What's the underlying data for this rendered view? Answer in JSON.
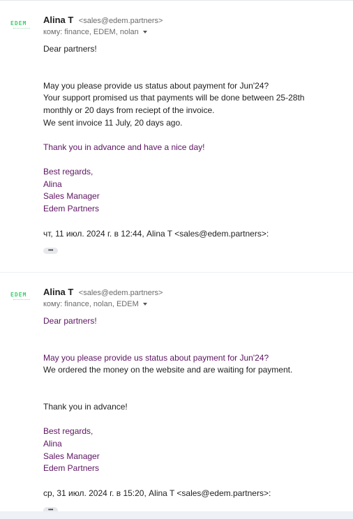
{
  "messages": [
    {
      "sender_name": "Alina T",
      "sender_email": "<sales@edem.partners>",
      "to": "кому: finance, EDEM, nolan",
      "logo_text": "EDEM",
      "body": {
        "greeting": "Dear partners!",
        "p1_line1": "May you please provide us status about payment for Jun'24?",
        "p1_line2": "Your support promised us that payments will be done between 25-28th",
        "p1_line3": "monthly or 20 days from reciept of the invoice.",
        "p1_line4": "We sent invoice 11 July, 20 days ago.",
        "thanks": "Thank you in advance and have a nice day!",
        "sig_regards": "Best regards,",
        "sig_name": "Alina",
        "sig_title": "Sales Manager",
        "sig_company": "Edem Partners"
      },
      "quote_header": "чт, 11 июл. 2024 г. в 12:44, Alina T <sales@edem.partners>:",
      "expand_label": "•••"
    },
    {
      "sender_name": "Alina T",
      "sender_email": "<sales@edem.partners>",
      "to": "кому: finance, nolan, EDEM",
      "logo_text": "EDEM",
      "body": {
        "greeting": "Dear partners!",
        "p1_line1": "May you please provide us status about payment for Jun'24?",
        "p1_line2": "We ordered the money on the website and are waiting for payment.",
        "thanks": "Thank you in advance!",
        "sig_regards": "Best regards,",
        "sig_name": "Alina",
        "sig_title": "Sales Manager",
        "sig_company": "Edem Partners"
      },
      "quote_header": "ср, 31 июл. 2024 г. в 15:20, Alina T <sales@edem.partners>:",
      "expand_label": "•••"
    }
  ],
  "colors": {
    "signature_purple": "#5c1461",
    "logo_green": "#3ccf6e",
    "page_background": "#eef1f5"
  }
}
